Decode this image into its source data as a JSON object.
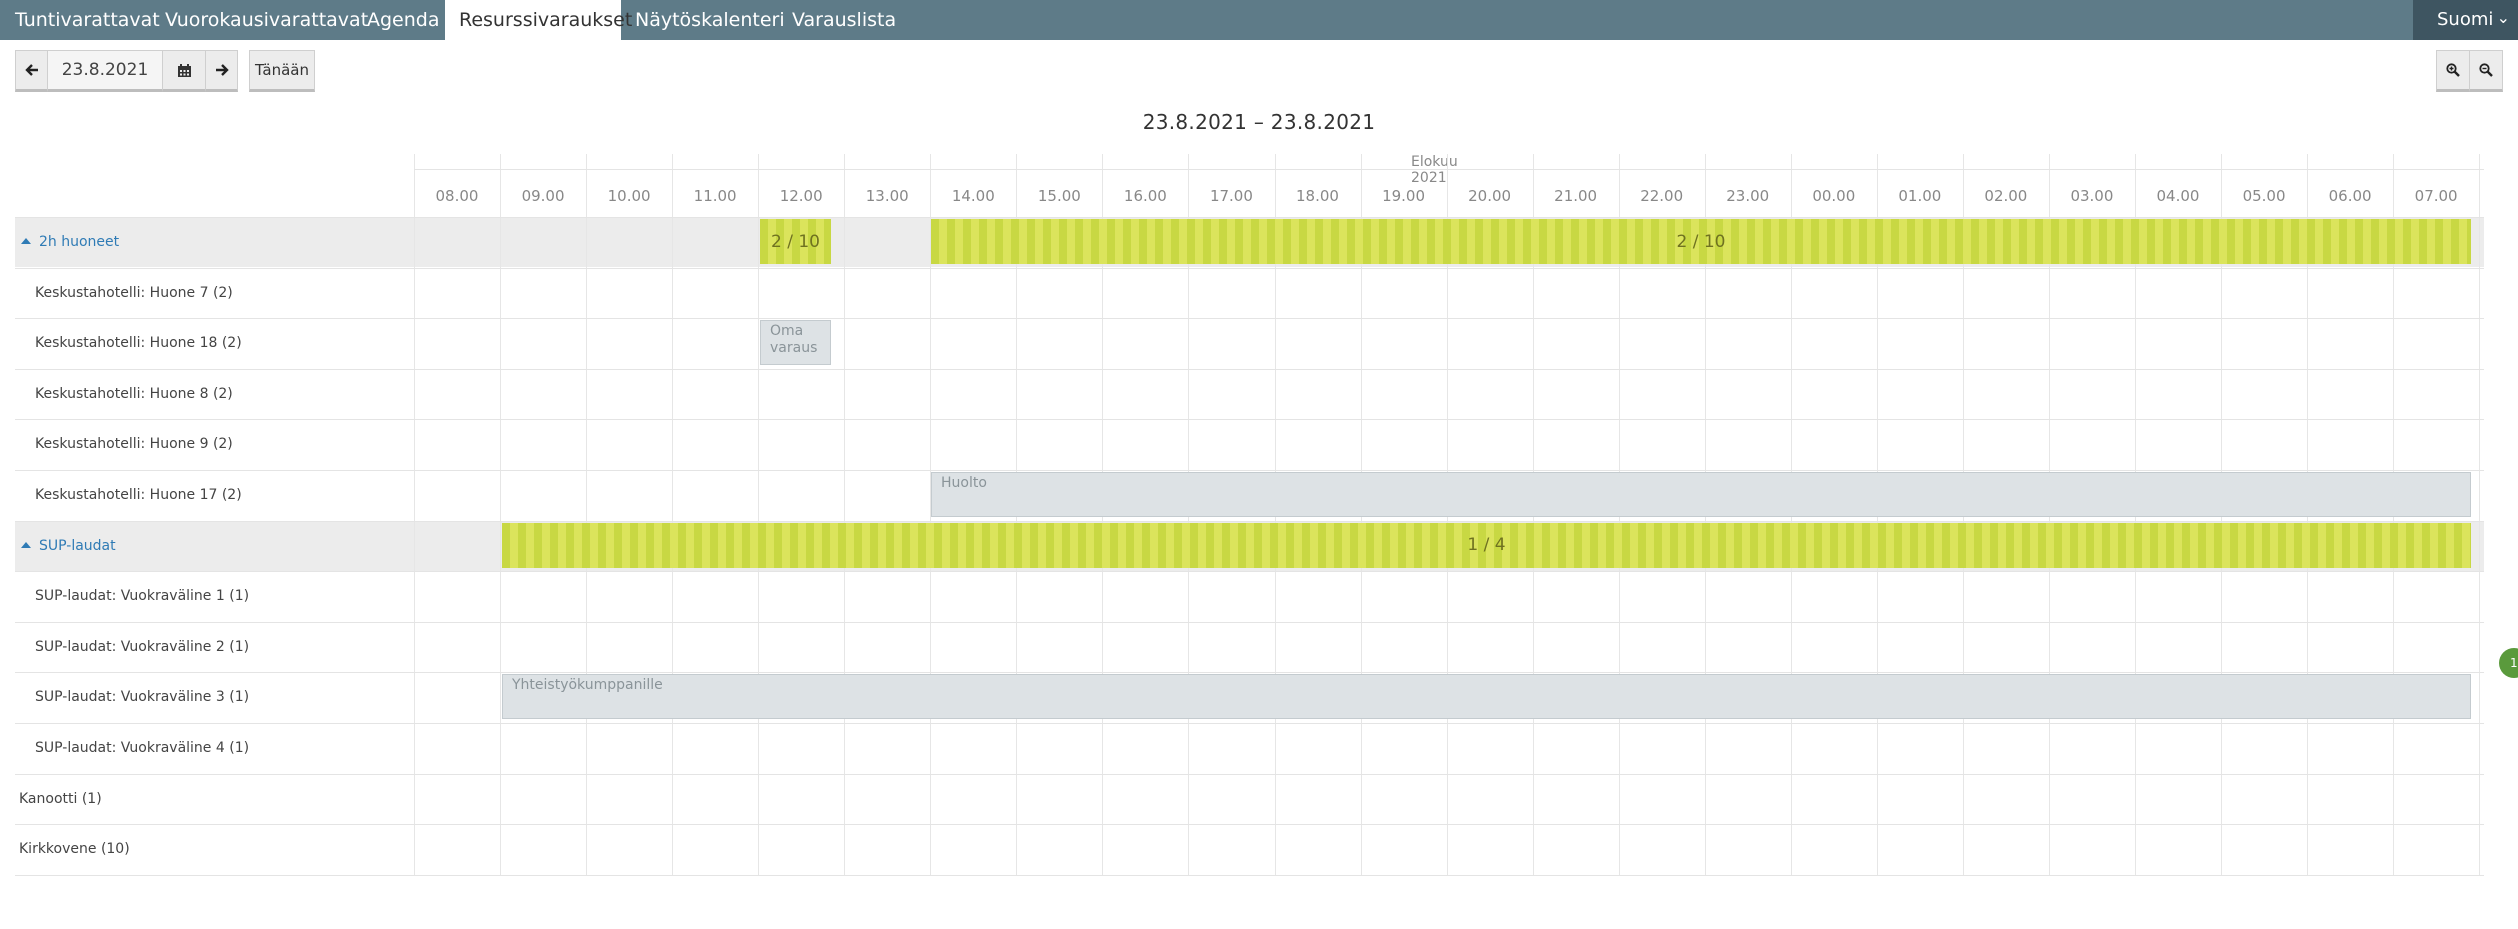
{
  "nav": {
    "tabs": [
      {
        "label": "Tuntivarattavat"
      },
      {
        "label": "Vuorokausivarattavat"
      },
      {
        "label": "Agenda"
      },
      {
        "label": "Resurssivaraukset"
      },
      {
        "label": "Näytöskalenteri"
      },
      {
        "label": "Varauslista"
      }
    ],
    "active_tab": "Resurssivaraukset",
    "language": "Suomi"
  },
  "toolbar": {
    "date_value": "23.8.2021",
    "today_label": "Tänään"
  },
  "calendar": {
    "range_title": "23.8.2021 – 23.8.2021",
    "month_label": "Elokuu 2021",
    "hours": [
      "08.00",
      "09.00",
      "10.00",
      "11.00",
      "12.00",
      "13.00",
      "14.00",
      "15.00",
      "16.00",
      "17.00",
      "18.00",
      "19.00",
      "20.00",
      "21.00",
      "22.00",
      "23.00",
      "00.00",
      "01.00",
      "02.00",
      "03.00",
      "04.00",
      "05.00",
      "06.00",
      "07.00"
    ],
    "rows": [
      {
        "label": "2h huoneet",
        "type": "group"
      },
      {
        "label": "Keskustahotelli: Huone 7 (2)",
        "type": "child"
      },
      {
        "label": "Keskustahotelli: Huone 18 (2)",
        "type": "child"
      },
      {
        "label": "Keskustahotelli: Huone 8 (2)",
        "type": "child"
      },
      {
        "label": "Keskustahotelli: Huone 9 (2)",
        "type": "child"
      },
      {
        "label": "Keskustahotelli: Huone 17 (2)",
        "type": "child"
      },
      {
        "label": "SUP-laudat",
        "type": "group"
      },
      {
        "label": "SUP-laudat: Vuokraväline 1 (1)",
        "type": "child"
      },
      {
        "label": "SUP-laudat: Vuokraväline 2 (1)",
        "type": "child"
      },
      {
        "label": "SUP-laudat: Vuokraväline 3 (1)",
        "type": "child"
      },
      {
        "label": "SUP-laudat: Vuokraväline 4 (1)",
        "type": "child"
      },
      {
        "label": "Kanootti (1)",
        "type": "item"
      },
      {
        "label": "Kirkkovene (10)",
        "type": "item"
      }
    ],
    "occupancy": [
      {
        "text": "2 / 10"
      },
      {
        "text": "2 / 10"
      },
      {
        "text": "1 / 4"
      }
    ],
    "reservations": [
      {
        "text": "Oma varaus"
      },
      {
        "text": "Huolto"
      },
      {
        "text": "Yhteistyökumppanille"
      }
    ]
  },
  "badge": {
    "text": "1"
  },
  "colors": {
    "nav_bg": "#5e7b88",
    "lang_bg": "#3e5561",
    "group_link": "#2f7bb5",
    "occupancy_stripe_a": "#c8d843",
    "occupancy_stripe_b": "#dbe45c",
    "reservation_bg": "#dde2e5",
    "badge": "#5a9a3c"
  }
}
